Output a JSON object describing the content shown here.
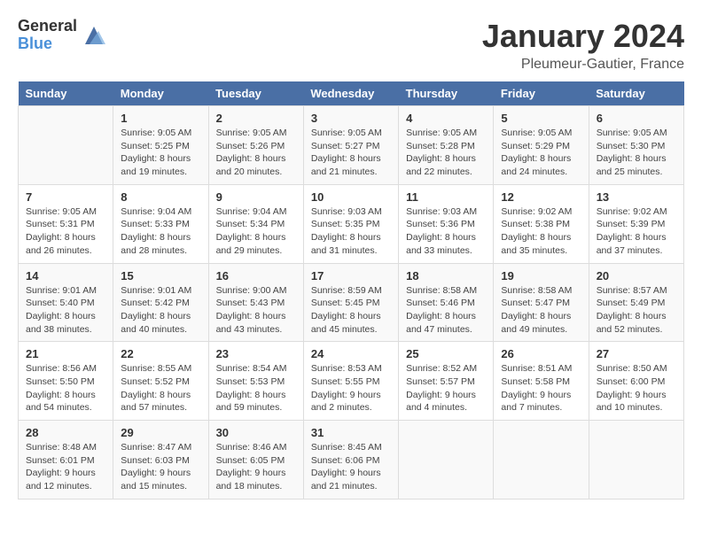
{
  "header": {
    "logo_general": "General",
    "logo_blue": "Blue",
    "month_title": "January 2024",
    "location": "Pleumeur-Gautier, France"
  },
  "weekdays": [
    "Sunday",
    "Monday",
    "Tuesday",
    "Wednesday",
    "Thursday",
    "Friday",
    "Saturday"
  ],
  "weeks": [
    [
      {
        "day": "",
        "info": ""
      },
      {
        "day": "1",
        "info": "Sunrise: 9:05 AM\nSunset: 5:25 PM\nDaylight: 8 hours\nand 19 minutes."
      },
      {
        "day": "2",
        "info": "Sunrise: 9:05 AM\nSunset: 5:26 PM\nDaylight: 8 hours\nand 20 minutes."
      },
      {
        "day": "3",
        "info": "Sunrise: 9:05 AM\nSunset: 5:27 PM\nDaylight: 8 hours\nand 21 minutes."
      },
      {
        "day": "4",
        "info": "Sunrise: 9:05 AM\nSunset: 5:28 PM\nDaylight: 8 hours\nand 22 minutes."
      },
      {
        "day": "5",
        "info": "Sunrise: 9:05 AM\nSunset: 5:29 PM\nDaylight: 8 hours\nand 24 minutes."
      },
      {
        "day": "6",
        "info": "Sunrise: 9:05 AM\nSunset: 5:30 PM\nDaylight: 8 hours\nand 25 minutes."
      }
    ],
    [
      {
        "day": "7",
        "info": "Sunrise: 9:05 AM\nSunset: 5:31 PM\nDaylight: 8 hours\nand 26 minutes."
      },
      {
        "day": "8",
        "info": "Sunrise: 9:04 AM\nSunset: 5:33 PM\nDaylight: 8 hours\nand 28 minutes."
      },
      {
        "day": "9",
        "info": "Sunrise: 9:04 AM\nSunset: 5:34 PM\nDaylight: 8 hours\nand 29 minutes."
      },
      {
        "day": "10",
        "info": "Sunrise: 9:03 AM\nSunset: 5:35 PM\nDaylight: 8 hours\nand 31 minutes."
      },
      {
        "day": "11",
        "info": "Sunrise: 9:03 AM\nSunset: 5:36 PM\nDaylight: 8 hours\nand 33 minutes."
      },
      {
        "day": "12",
        "info": "Sunrise: 9:02 AM\nSunset: 5:38 PM\nDaylight: 8 hours\nand 35 minutes."
      },
      {
        "day": "13",
        "info": "Sunrise: 9:02 AM\nSunset: 5:39 PM\nDaylight: 8 hours\nand 37 minutes."
      }
    ],
    [
      {
        "day": "14",
        "info": "Sunrise: 9:01 AM\nSunset: 5:40 PM\nDaylight: 8 hours\nand 38 minutes."
      },
      {
        "day": "15",
        "info": "Sunrise: 9:01 AM\nSunset: 5:42 PM\nDaylight: 8 hours\nand 40 minutes."
      },
      {
        "day": "16",
        "info": "Sunrise: 9:00 AM\nSunset: 5:43 PM\nDaylight: 8 hours\nand 43 minutes."
      },
      {
        "day": "17",
        "info": "Sunrise: 8:59 AM\nSunset: 5:45 PM\nDaylight: 8 hours\nand 45 minutes."
      },
      {
        "day": "18",
        "info": "Sunrise: 8:58 AM\nSunset: 5:46 PM\nDaylight: 8 hours\nand 47 minutes."
      },
      {
        "day": "19",
        "info": "Sunrise: 8:58 AM\nSunset: 5:47 PM\nDaylight: 8 hours\nand 49 minutes."
      },
      {
        "day": "20",
        "info": "Sunrise: 8:57 AM\nSunset: 5:49 PM\nDaylight: 8 hours\nand 52 minutes."
      }
    ],
    [
      {
        "day": "21",
        "info": "Sunrise: 8:56 AM\nSunset: 5:50 PM\nDaylight: 8 hours\nand 54 minutes."
      },
      {
        "day": "22",
        "info": "Sunrise: 8:55 AM\nSunset: 5:52 PM\nDaylight: 8 hours\nand 57 minutes."
      },
      {
        "day": "23",
        "info": "Sunrise: 8:54 AM\nSunset: 5:53 PM\nDaylight: 8 hours\nand 59 minutes."
      },
      {
        "day": "24",
        "info": "Sunrise: 8:53 AM\nSunset: 5:55 PM\nDaylight: 9 hours\nand 2 minutes."
      },
      {
        "day": "25",
        "info": "Sunrise: 8:52 AM\nSunset: 5:57 PM\nDaylight: 9 hours\nand 4 minutes."
      },
      {
        "day": "26",
        "info": "Sunrise: 8:51 AM\nSunset: 5:58 PM\nDaylight: 9 hours\nand 7 minutes."
      },
      {
        "day": "27",
        "info": "Sunrise: 8:50 AM\nSunset: 6:00 PM\nDaylight: 9 hours\nand 10 minutes."
      }
    ],
    [
      {
        "day": "28",
        "info": "Sunrise: 8:48 AM\nSunset: 6:01 PM\nDaylight: 9 hours\nand 12 minutes."
      },
      {
        "day": "29",
        "info": "Sunrise: 8:47 AM\nSunset: 6:03 PM\nDaylight: 9 hours\nand 15 minutes."
      },
      {
        "day": "30",
        "info": "Sunrise: 8:46 AM\nSunset: 6:05 PM\nDaylight: 9 hours\nand 18 minutes."
      },
      {
        "day": "31",
        "info": "Sunrise: 8:45 AM\nSunset: 6:06 PM\nDaylight: 9 hours\nand 21 minutes."
      },
      {
        "day": "",
        "info": ""
      },
      {
        "day": "",
        "info": ""
      },
      {
        "day": "",
        "info": ""
      }
    ]
  ]
}
